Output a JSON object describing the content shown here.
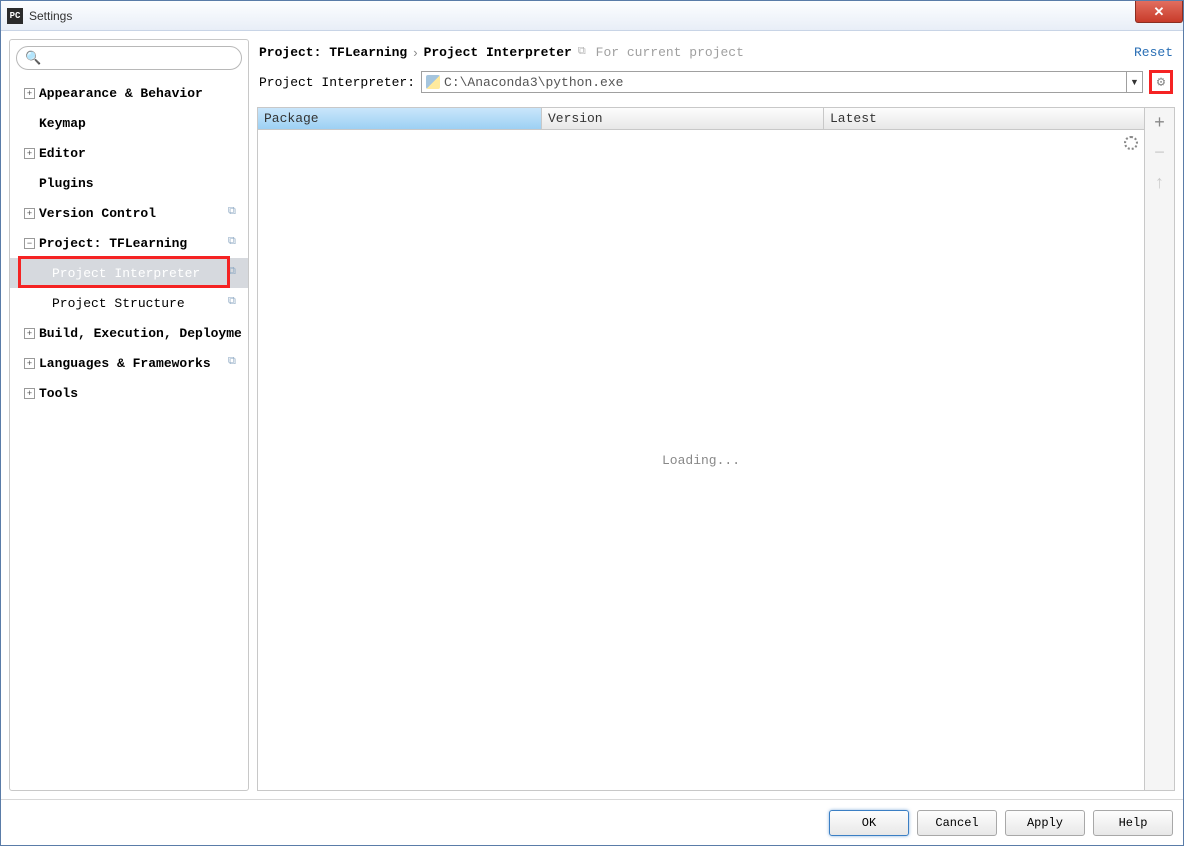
{
  "window": {
    "title": "Settings",
    "app_icon_text": "PC"
  },
  "sidebar": {
    "search_placeholder": "",
    "items": [
      {
        "label": "Appearance & Behavior",
        "expandable": true,
        "expanded": false
      },
      {
        "label": "Keymap",
        "expandable": false
      },
      {
        "label": "Editor",
        "expandable": true,
        "expanded": false
      },
      {
        "label": "Plugins",
        "expandable": false
      },
      {
        "label": "Version Control",
        "expandable": true,
        "expanded": false,
        "modified": true
      },
      {
        "label": "Project: TFLearning",
        "expandable": true,
        "expanded": true,
        "modified": true
      },
      {
        "label": "Project Interpreter",
        "child": true,
        "selected": true,
        "highlighted": true,
        "modified": true
      },
      {
        "label": "Project Structure",
        "child": true,
        "modified": true
      },
      {
        "label": "Build, Execution, Deployme",
        "expandable": true,
        "expanded": false
      },
      {
        "label": "Languages & Frameworks",
        "expandable": true,
        "expanded": false,
        "modified": true
      },
      {
        "label": "Tools",
        "expandable": true,
        "expanded": false
      }
    ]
  },
  "breadcrumb": {
    "root": "Project: TFLearning",
    "current": "Project Interpreter",
    "hint": "For current project",
    "reset": "Reset"
  },
  "interpreter": {
    "label": "Project Interpreter:",
    "path": "C:\\Anaconda3\\python.exe"
  },
  "table": {
    "columns": {
      "package": "Package",
      "version": "Version",
      "latest": "Latest"
    },
    "loading_text": "Loading..."
  },
  "buttons": {
    "ok": "OK",
    "cancel": "Cancel",
    "apply": "Apply",
    "help": "Help"
  }
}
